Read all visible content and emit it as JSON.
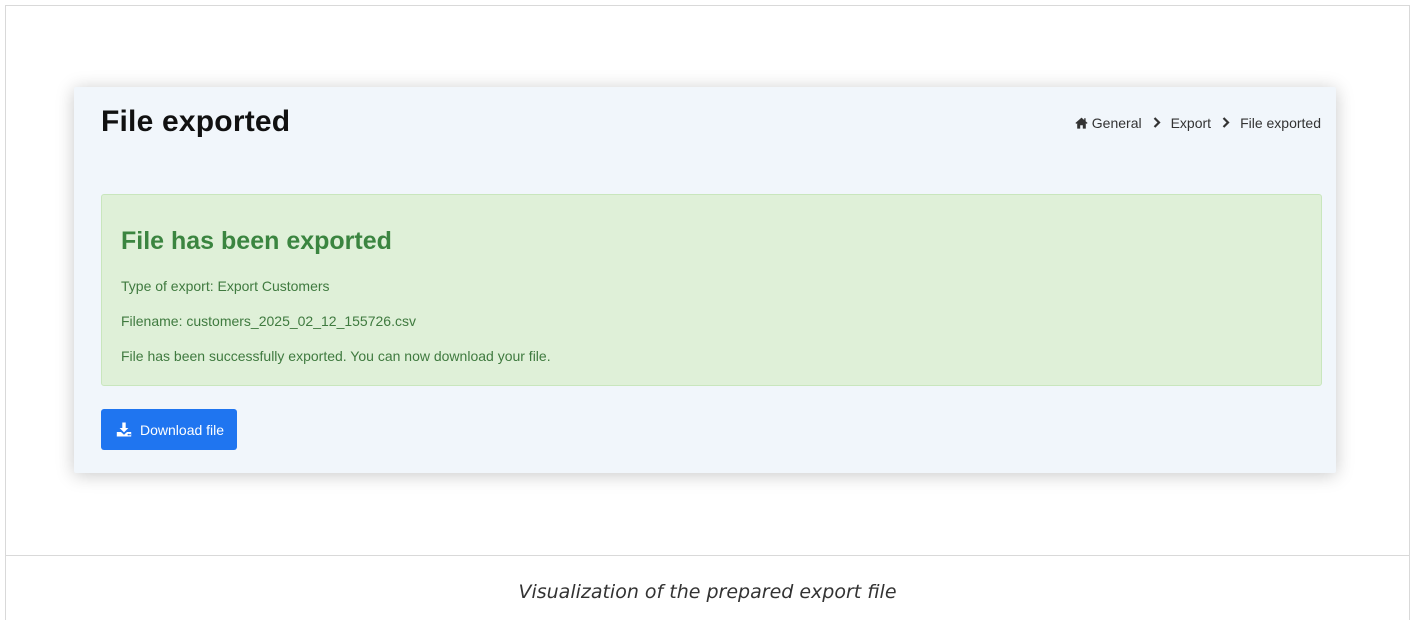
{
  "header": {
    "title": "File exported"
  },
  "breadcrumb": {
    "items": [
      "General",
      "Export",
      "File exported"
    ],
    "home_icon": "home-icon",
    "separator_icon": "chevron-right-icon"
  },
  "alert": {
    "heading": "File has been exported",
    "type_line": "Type of export: Export Customers",
    "filename_line": "Filename: customers_2025_02_12_155726.csv",
    "message": "File has been successfully exported. You can now download your file."
  },
  "actions": {
    "download_label": "Download file",
    "download_icon": "download-icon"
  },
  "caption": "Visualization of the prepared export file",
  "colors": {
    "card_background": "#f1f6fb",
    "alert_background": "#dff0d8",
    "alert_text": "#3b8540",
    "button_background": "#1f75f0"
  }
}
